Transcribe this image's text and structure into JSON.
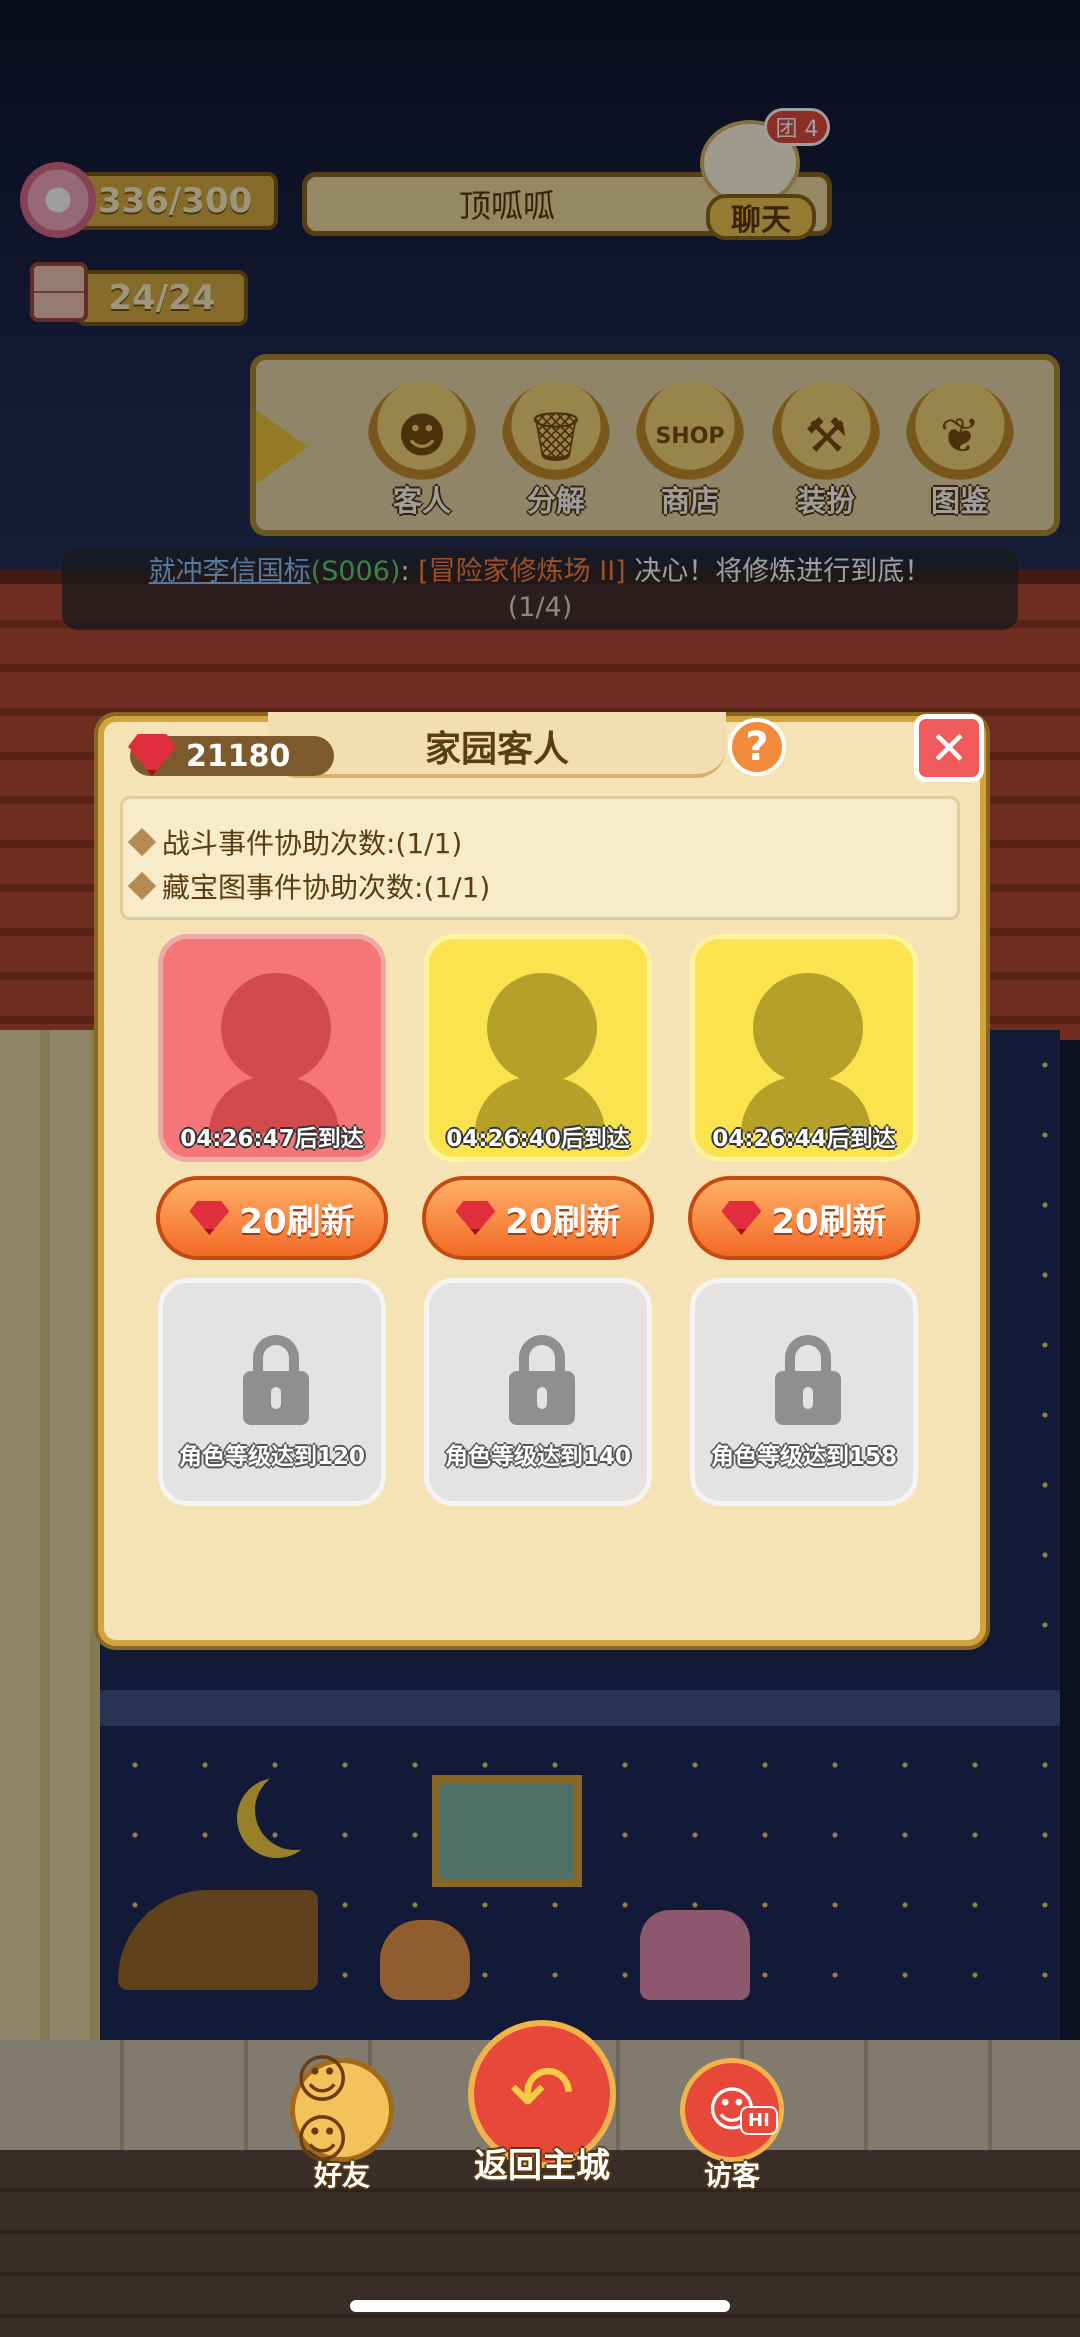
{
  "hud": {
    "flower_value": "336/300",
    "storage_value": "24/24",
    "player_name": "顶呱呱",
    "chat_label": "聊天",
    "chat_badge": "团 4"
  },
  "menu": [
    {
      "label": "客人",
      "icon": "guest-icon",
      "glyph": "☻"
    },
    {
      "label": "分解",
      "icon": "trash-icon",
      "glyph": "🗑"
    },
    {
      "label": "商店",
      "icon": "shop-icon",
      "glyph": "SHOP"
    },
    {
      "label": "装扮",
      "icon": "hammer-icon",
      "glyph": "⚒"
    },
    {
      "label": "图鉴",
      "icon": "book-icon",
      "glyph": "❦"
    }
  ],
  "task": {
    "who": "就冲李信国标",
    "code": "(S006)",
    "sep": ": ",
    "quest": "[冒险家修炼场 II]",
    "text": " 决心！将修炼进行到底！",
    "progress": "(1/4)"
  },
  "dialog": {
    "title": "家园客人",
    "gems": "21180",
    "help": "?",
    "close": "✕",
    "info": [
      "战斗事件协助次数:(1/1)",
      "藏宝图事件协助次数:(1/1)"
    ],
    "guests": [
      {
        "time": "04:26:47后到达",
        "color": "red"
      },
      {
        "time": "04:26:40后到达",
        "color": "yellow"
      },
      {
        "time": "04:26:44后到达",
        "color": "yellow"
      }
    ],
    "refresh_label": "20刷新",
    "locked": [
      "角色等级达到120",
      "角色等级达到140",
      "角色等级达到158"
    ]
  },
  "nav": {
    "friends": "好友",
    "return": "返回主城",
    "visitors": "访客",
    "hi": "HI"
  },
  "colors": {
    "accent_gold": "#d2a43e",
    "refresh_orange": "#f26a26",
    "gem_red": "#e12e3e"
  }
}
